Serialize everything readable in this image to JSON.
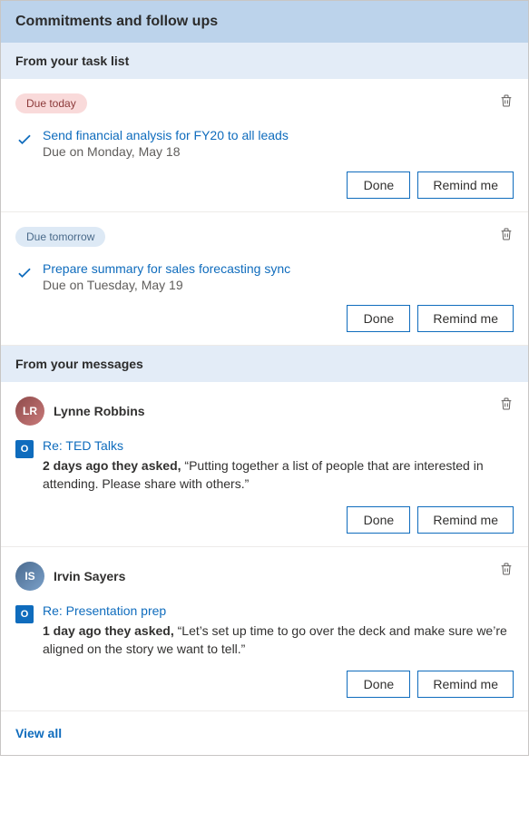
{
  "header": {
    "title": "Commitments and follow ups"
  },
  "sections": {
    "tasks": {
      "header": "From your task list",
      "items": [
        {
          "badge": "Due today",
          "badgeClass": "badge-today",
          "title": "Send financial analysis for FY20 to all leads",
          "due": "Due on Monday, May 18"
        },
        {
          "badge": "Due tomorrow",
          "badgeClass": "badge-tomorrow",
          "title": "Prepare summary for sales forecasting sync",
          "due": "Due on Tuesday, May 19"
        }
      ]
    },
    "messages": {
      "header": "From your messages",
      "items": [
        {
          "sender": "Lynne Robbins",
          "avatarInitials": "LR",
          "subject": "Re: TED Talks",
          "prefix": "2 days ago they asked,",
          "quote": " “Putting together a list of people that are interested in attending. Please share with others.”"
        },
        {
          "sender": "Irvin Sayers",
          "avatarInitials": "IS",
          "subject": "Re: Presentation prep",
          "prefix": "1 day ago they asked,",
          "quote": " “Let’s set up time to go over the deck and make sure we’re aligned on the story we want to tell.”"
        }
      ]
    }
  },
  "buttons": {
    "done": "Done",
    "remind": "Remind me"
  },
  "footer": {
    "viewAll": "View all"
  }
}
